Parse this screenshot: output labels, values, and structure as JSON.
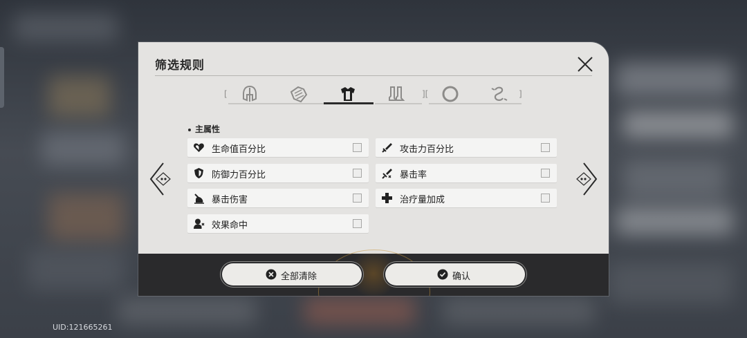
{
  "background": {
    "uid_text": "UID:121665261"
  },
  "dialog": {
    "title": "筛选规则",
    "close_icon": "close-x-icon",
    "tabs": [
      {
        "icon": "head-icon",
        "active": false
      },
      {
        "icon": "hands-icon",
        "active": false
      },
      {
        "icon": "body-icon",
        "active": true
      },
      {
        "icon": "feet-icon",
        "active": false
      },
      {
        "icon": "planar-sphere-icon",
        "active": false
      },
      {
        "icon": "link-rope-icon",
        "active": false
      }
    ],
    "section_title": "主属性",
    "options": [
      {
        "label": "生命值百分比",
        "icon": "heart-icon",
        "checked": false
      },
      {
        "label": "攻击力百分比",
        "icon": "sword-icon",
        "checked": false
      },
      {
        "label": "防御力百分比",
        "icon": "shield-icon",
        "checked": false
      },
      {
        "label": "暴击率",
        "icon": "crit-rate-icon",
        "checked": false
      },
      {
        "label": "暴击伤害",
        "icon": "crit-damage-icon",
        "checked": false
      },
      {
        "label": "治疗量加成",
        "icon": "healing-cross-icon",
        "checked": false
      },
      {
        "label": "效果命中",
        "icon": "effect-hit-icon",
        "checked": false
      }
    ],
    "buttons": {
      "clear_label": "全部清除",
      "confirm_label": "确认"
    }
  },
  "colors": {
    "panel": "#e4e3e1",
    "footer": "#2a2a2c",
    "option_bg": "#f4f4f3",
    "text": "#222222"
  }
}
